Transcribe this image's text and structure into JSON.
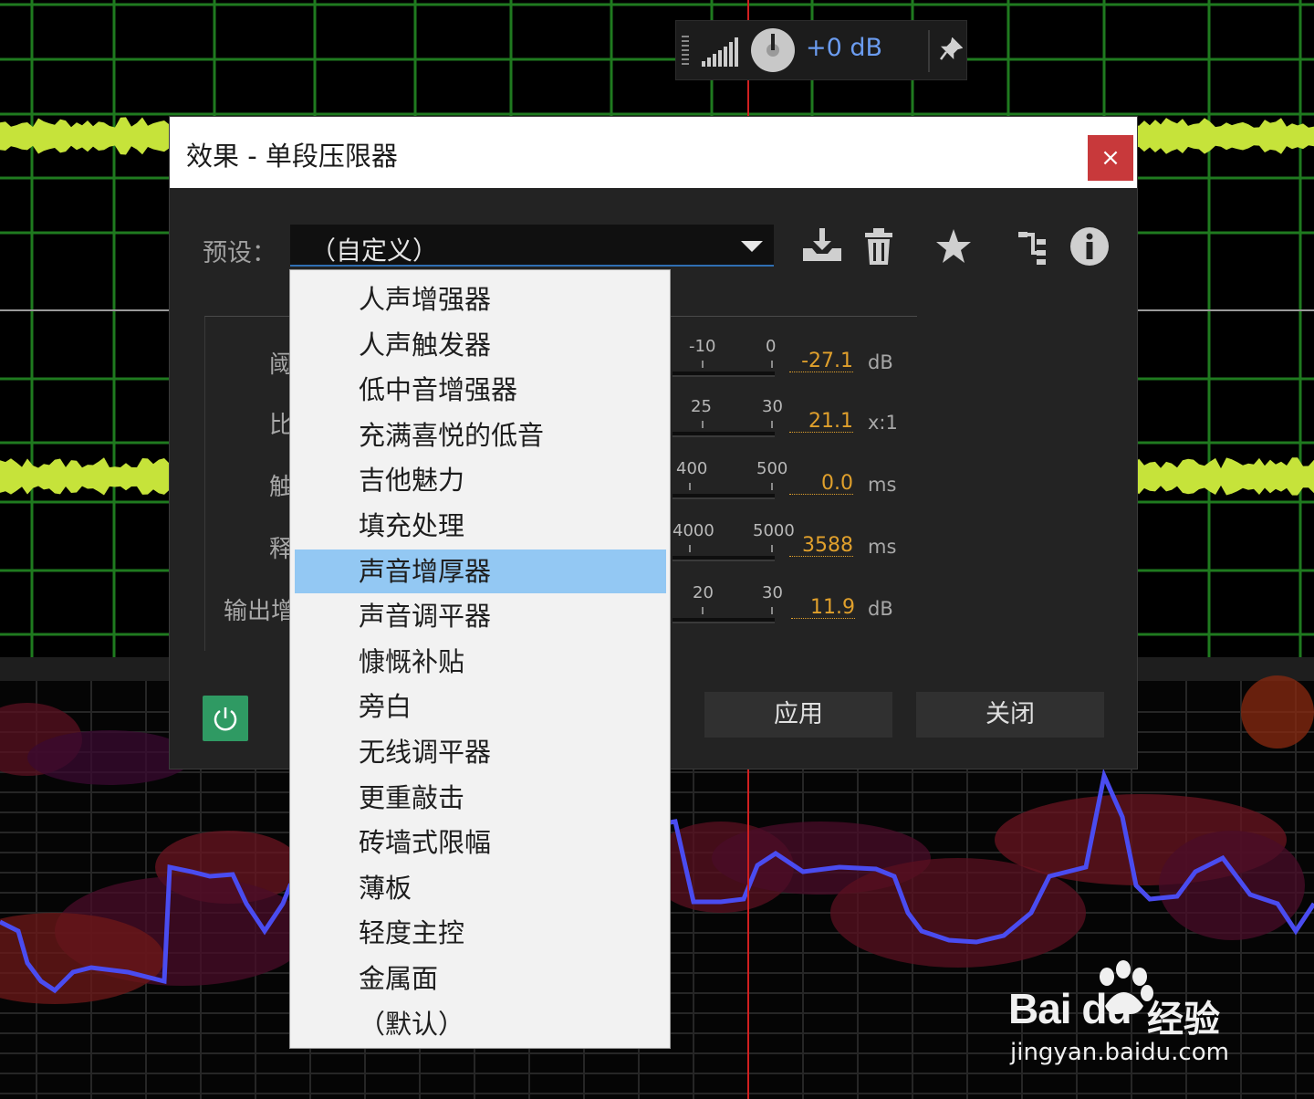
{
  "hud": {
    "gain_value": "+0 dB"
  },
  "dialog": {
    "title": "效果 - 单段压限器",
    "close_glyph": "×",
    "preset_label": "预设：",
    "preset_value": "（自定义）",
    "params": [
      {
        "label": "阈",
        "ticks": [
          "-10",
          "0"
        ],
        "value": "-27.1",
        "unit": "dB"
      },
      {
        "label": "比",
        "ticks": [
          "25",
          "30"
        ],
        "value": "21.1",
        "unit": "x:1"
      },
      {
        "label": "触",
        "ticks": [
          "400",
          "500"
        ],
        "value": "0.0",
        "unit": "ms"
      },
      {
        "label": "释",
        "ticks": [
          "4000",
          "5000"
        ],
        "value": "3588",
        "unit": "ms"
      },
      {
        "label": "输出增",
        "ticks": [
          "20",
          "30"
        ],
        "value": "11.9",
        "unit": "dB"
      }
    ],
    "apply_label": "应用",
    "close_label": "关闭"
  },
  "dropdown": {
    "items": [
      "人声增强器",
      "人声触发器",
      "低中音增强器",
      "充满喜悦的低音",
      "吉他魅力",
      "填充处理",
      "声音增厚器",
      "声音调平器",
      "慷慨补贴",
      "旁白",
      "无线调平器",
      "更重敲击",
      "砖墙式限幅",
      "薄板",
      "轻度主控",
      "金属面",
      "（默认）"
    ],
    "selected_index": 6
  },
  "watermark": {
    "brand": "Bai du",
    "cn": "经验",
    "url": "jingyan.baidu.com"
  },
  "colors": {
    "waveform": "#c6e33a",
    "grid": "#1f7a1f",
    "playhead": "#d02020",
    "pitch_line": "#4a4cf0",
    "value_orange": "#e0a02c",
    "dropdown_selected": "#93c8f3",
    "power_green": "#2f9a63",
    "close_red": "#c8393b"
  }
}
